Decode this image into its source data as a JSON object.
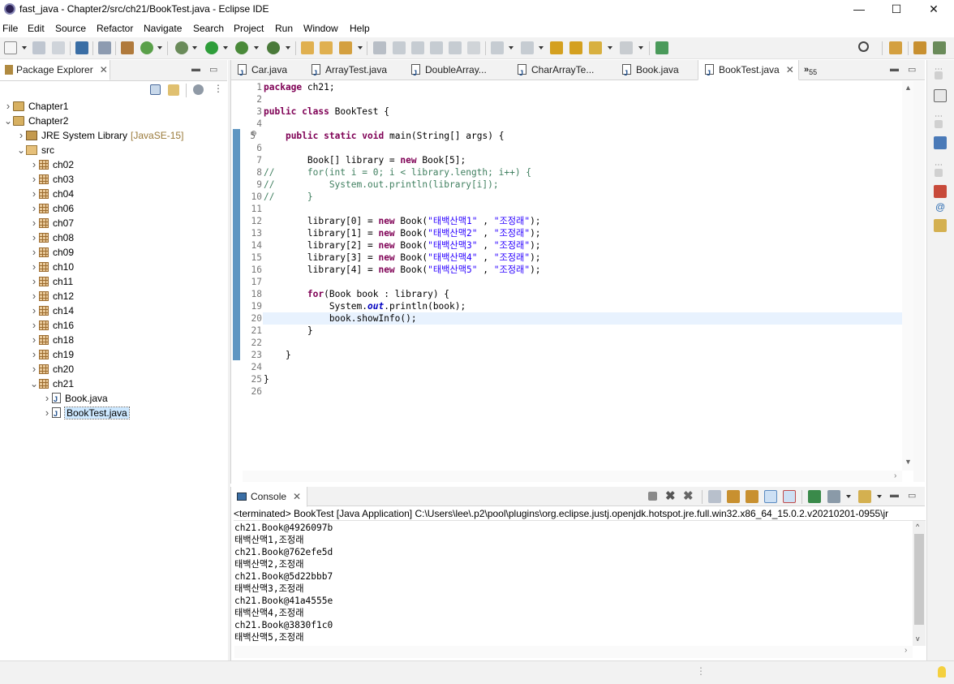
{
  "window": {
    "title": "fast_java - Chapter2/src/ch21/BookTest.java - Eclipse IDE",
    "minimize": "—",
    "maximize": "☐",
    "close": "✕"
  },
  "menu": [
    "File",
    "Edit",
    "Source",
    "Refactor",
    "Navigate",
    "Search",
    "Project",
    "Run",
    "Window",
    "Help"
  ],
  "package_explorer": {
    "title": "Package Explorer",
    "tree": [
      {
        "label": "Chapter1",
        "depth": 0,
        "expanded": false,
        "icon": "project-icon"
      },
      {
        "label": "Chapter2",
        "depth": 0,
        "expanded": true,
        "icon": "project-icon"
      },
      {
        "label": "JRE System Library",
        "suffix": "[JavaSE-15]",
        "depth": 1,
        "expanded": false,
        "icon": "library-icon"
      },
      {
        "label": "src",
        "depth": 1,
        "expanded": true,
        "icon": "source-folder-icon"
      },
      {
        "label": "ch02",
        "depth": 2,
        "expanded": false,
        "icon": "package-icon"
      },
      {
        "label": "ch03",
        "depth": 2,
        "expanded": false,
        "icon": "package-icon"
      },
      {
        "label": "ch04",
        "depth": 2,
        "expanded": false,
        "icon": "package-icon"
      },
      {
        "label": "ch06",
        "depth": 2,
        "expanded": false,
        "icon": "package-icon"
      },
      {
        "label": "ch07",
        "depth": 2,
        "expanded": false,
        "icon": "package-icon"
      },
      {
        "label": "ch08",
        "depth": 2,
        "expanded": false,
        "icon": "package-icon"
      },
      {
        "label": "ch09",
        "depth": 2,
        "expanded": false,
        "icon": "package-icon"
      },
      {
        "label": "ch10",
        "depth": 2,
        "expanded": false,
        "icon": "package-icon"
      },
      {
        "label": "ch11",
        "depth": 2,
        "expanded": false,
        "icon": "package-icon"
      },
      {
        "label": "ch12",
        "depth": 2,
        "expanded": false,
        "icon": "package-icon"
      },
      {
        "label": "ch14",
        "depth": 2,
        "expanded": false,
        "icon": "package-icon"
      },
      {
        "label": "ch16",
        "depth": 2,
        "expanded": false,
        "icon": "package-icon"
      },
      {
        "label": "ch18",
        "depth": 2,
        "expanded": false,
        "icon": "package-warning-icon"
      },
      {
        "label": "ch19",
        "depth": 2,
        "expanded": false,
        "icon": "package-warning-icon"
      },
      {
        "label": "ch20",
        "depth": 2,
        "expanded": false,
        "icon": "package-icon"
      },
      {
        "label": "ch21",
        "depth": 2,
        "expanded": true,
        "icon": "package-icon"
      },
      {
        "label": "Book.java",
        "depth": 3,
        "expanded": false,
        "icon": "java-file-icon"
      },
      {
        "label": "BookTest.java",
        "depth": 3,
        "expanded": false,
        "icon": "java-file-icon",
        "selected": true
      }
    ]
  },
  "editor": {
    "tabs": [
      {
        "label": "Car.java",
        "active": false
      },
      {
        "label": "ArrayTest.java",
        "active": false
      },
      {
        "label": "DoubleArray...",
        "active": false
      },
      {
        "label": "CharArrayTe...",
        "active": false
      },
      {
        "label": "Book.java",
        "active": false
      },
      {
        "label": "BookTest.java",
        "active": true
      }
    ],
    "overflow_label": "»",
    "overflow_count": "55",
    "line_numbers": [
      "1",
      "2",
      "3",
      "4",
      "5",
      "6",
      "7",
      "8",
      "9",
      "10",
      "11",
      "12",
      "13",
      "14",
      "15",
      "16",
      "17",
      "18",
      "19",
      "20",
      "21",
      "22",
      "23",
      "24",
      "25",
      "26"
    ],
    "fold_marker": "⊖",
    "current_line": "20"
  },
  "console": {
    "title": "Console",
    "status": "<terminated> BookTest [Java Application] C:\\Users\\lee\\.p2\\pool\\plugins\\org.eclipse.justj.openjdk.hotspot.jre.full.win32.x86_64_15.0.2.v20210201-0955\\jr",
    "output": [
      "ch21.Book@4926097b",
      "태백산맥1,조정래",
      "ch21.Book@762efe5d",
      "태백산맥2,조정래",
      "ch21.Book@5d22bbb7",
      "태백산맥3,조정래",
      "ch21.Book@41a4555e",
      "태백산맥4,조정래",
      "ch21.Book@3830f1c0",
      "태백산맥5,조정래"
    ]
  },
  "colors": {
    "keyword": "#7f0055",
    "string": "#2a00ff",
    "comment": "#3f7f5f",
    "current_line": "#e8f2fe",
    "selection": "#cde8ff"
  }
}
